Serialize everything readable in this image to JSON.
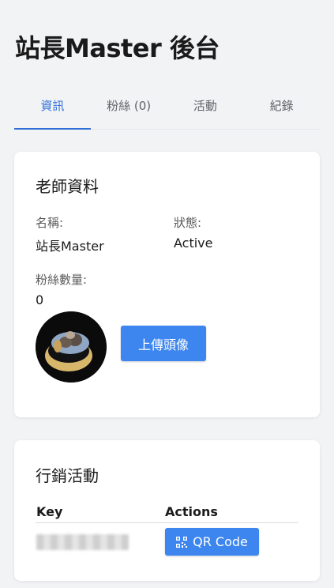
{
  "header": {
    "title": "站長Master 後台"
  },
  "tabs": [
    {
      "label": "資訊",
      "active": true
    },
    {
      "label": "粉絲 (0)",
      "active": false
    },
    {
      "label": "活動",
      "active": false
    },
    {
      "label": "紀錄",
      "active": false
    }
  ],
  "teacher": {
    "title": "老師資料",
    "name_label": "名稱:",
    "name_value": "站長Master",
    "status_label": "狀態:",
    "status_value": "Active",
    "followers_label": "粉絲數量:",
    "followers_value": "0",
    "upload_label": "上傳頭像"
  },
  "marketing": {
    "title": "行銷活動",
    "columns": [
      "Key",
      "Actions"
    ],
    "rows": [
      {
        "key": "",
        "action_label": "QR Code"
      }
    ]
  },
  "colors": {
    "accent": "#2f6fd8",
    "button": "#3d86f0",
    "background": "#f2f3f5"
  },
  "icons": {
    "qr": "qr-code-icon"
  }
}
